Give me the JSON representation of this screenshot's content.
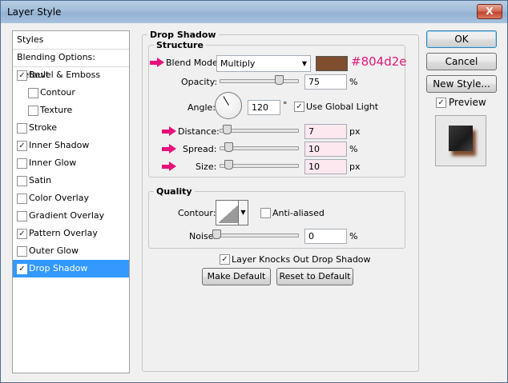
{
  "window": {
    "title": "Layer Style",
    "close_label": "X"
  },
  "sidebar": {
    "items": [
      {
        "label": "Styles",
        "checkable": false,
        "checked": false,
        "indent": false,
        "selected": false
      },
      {
        "label": "Blending Options: Default",
        "checkable": false,
        "checked": false,
        "indent": false,
        "selected": false
      },
      {
        "label": "Bevel & Emboss",
        "checkable": true,
        "checked": true,
        "indent": false,
        "selected": false
      },
      {
        "label": "Contour",
        "checkable": true,
        "checked": false,
        "indent": true,
        "selected": false
      },
      {
        "label": "Texture",
        "checkable": true,
        "checked": false,
        "indent": true,
        "selected": false
      },
      {
        "label": "Stroke",
        "checkable": true,
        "checked": false,
        "indent": false,
        "selected": false
      },
      {
        "label": "Inner Shadow",
        "checkable": true,
        "checked": true,
        "indent": false,
        "selected": false
      },
      {
        "label": "Inner Glow",
        "checkable": true,
        "checked": false,
        "indent": false,
        "selected": false
      },
      {
        "label": "Satin",
        "checkable": true,
        "checked": false,
        "indent": false,
        "selected": false
      },
      {
        "label": "Color Overlay",
        "checkable": true,
        "checked": false,
        "indent": false,
        "selected": false
      },
      {
        "label": "Gradient Overlay",
        "checkable": true,
        "checked": false,
        "indent": false,
        "selected": false
      },
      {
        "label": "Pattern Overlay",
        "checkable": true,
        "checked": true,
        "indent": false,
        "selected": false
      },
      {
        "label": "Outer Glow",
        "checkable": true,
        "checked": false,
        "indent": false,
        "selected": false
      },
      {
        "label": "Drop Shadow",
        "checkable": true,
        "checked": true,
        "indent": false,
        "selected": true
      }
    ]
  },
  "drop_shadow": {
    "section_title": "Drop Shadow",
    "structure": {
      "title": "Structure",
      "blend_mode_label": "Blend Mode:",
      "blend_mode_value": "Multiply",
      "shadow_color": "#804d2e",
      "color_annotation": "#804d2e",
      "opacity_label": "Opacity:",
      "opacity_value": "75",
      "opacity_unit": "%",
      "opacity_fraction": 0.75,
      "angle_label": "Angle:",
      "angle_value": "120",
      "angle_unit": "°",
      "use_global_light_label": "Use Global Light",
      "use_global_light_checked": true,
      "distance_label": "Distance:",
      "distance_value": "7",
      "distance_unit": "px",
      "spread_label": "Spread:",
      "spread_value": "10",
      "spread_unit": "%",
      "size_label": "Size:",
      "size_value": "10",
      "size_unit": "px"
    },
    "quality": {
      "title": "Quality",
      "contour_label": "Contour:",
      "anti_aliased_label": "Anti-aliased",
      "anti_aliased_checked": false,
      "noise_label": "Noise:",
      "noise_value": "0",
      "noise_unit": "%"
    },
    "layer_knocks_out_label": "Layer Knocks Out Drop Shadow",
    "layer_knocks_out_checked": true,
    "make_default_label": "Make Default",
    "reset_default_label": "Reset to Default"
  },
  "buttons": {
    "ok_label": "OK",
    "cancel_label": "Cancel",
    "new_style_label": "New Style...",
    "preview_label": "Preview",
    "preview_checked": true
  },
  "colors": {
    "annotation_pink": "#e8107a",
    "selection_blue": "#3399ff"
  },
  "icons": [
    "close-icon",
    "checkmark-icon",
    "chevron-down-icon",
    "pink-arrow-icon",
    "angle-dial-icon",
    "contour-curve-icon"
  ]
}
